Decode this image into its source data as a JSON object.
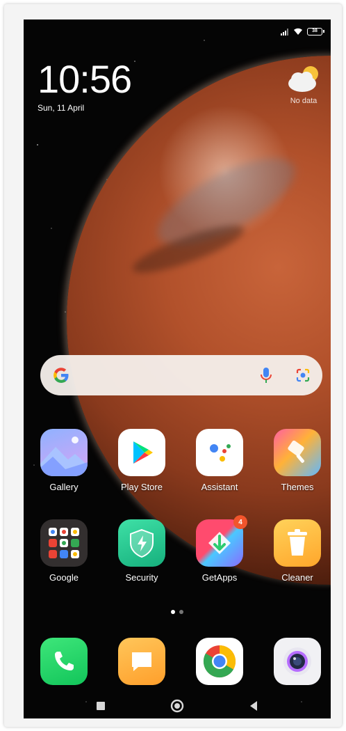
{
  "status_bar": {
    "battery": "38",
    "icons": [
      "signal-icon",
      "wifi-icon",
      "battery-icon"
    ]
  },
  "clock": {
    "time": "10:56",
    "date": "Sun, 11 April"
  },
  "weather": {
    "icon": "partly-cloudy-icon",
    "label": "No data"
  },
  "search_bar": {
    "icons": [
      "google-g-icon",
      "mic-icon",
      "lens-icon"
    ]
  },
  "apps": [
    {
      "label": "Gallery",
      "icon": "gallery-icon"
    },
    {
      "label": "Play Store",
      "icon": "play-store-icon"
    },
    {
      "label": "Assistant",
      "icon": "assistant-icon"
    },
    {
      "label": "Themes",
      "icon": "themes-icon"
    },
    {
      "label": "Google",
      "icon": "google-folder-icon"
    },
    {
      "label": "Security",
      "icon": "security-icon"
    },
    {
      "label": "GetApps",
      "icon": "getapps-icon",
      "badge": "4"
    },
    {
      "label": "Cleaner",
      "icon": "cleaner-icon"
    }
  ],
  "page_indicator": {
    "pages": 2,
    "current": 1
  },
  "dock": [
    {
      "icon": "phone-icon"
    },
    {
      "icon": "messages-icon"
    },
    {
      "icon": "chrome-icon"
    },
    {
      "icon": "camera-icon"
    }
  ],
  "nav_bar": {
    "icons": [
      "recents-icon",
      "home-icon",
      "back-icon"
    ]
  },
  "colors": {
    "accent_blue": "#4285f4",
    "accent_green": "#34a853",
    "accent_yellow": "#fbbc05",
    "accent_red": "#ea4335",
    "badge": "#f2552c"
  }
}
